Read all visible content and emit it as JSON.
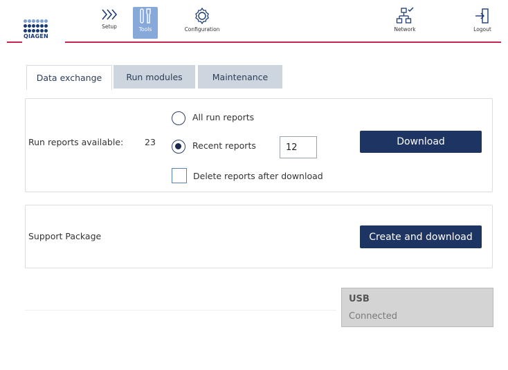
{
  "brand": {
    "logo_text": "QIAGEN",
    "accent_color": "#c8234f",
    "primary_color": "#1e3563"
  },
  "nav": {
    "setup": {
      "label": "Setup",
      "icon": "setup-chevrons-icon"
    },
    "tools": {
      "label": "Tools",
      "icon": "tools-icon",
      "active": true
    },
    "configuration": {
      "label": "Configuration",
      "icon": "gear-icon"
    },
    "network": {
      "label": "Network",
      "icon": "network-connected-icon"
    },
    "logout": {
      "label": "Logout",
      "icon": "logout-icon"
    }
  },
  "tabs": [
    {
      "label": "Data exchange",
      "active": true
    },
    {
      "label": "Run modules",
      "active": false
    },
    {
      "label": "Maintenance",
      "active": false
    }
  ],
  "run_reports": {
    "label": "Run reports available:",
    "count": "23",
    "option_all": "All run reports",
    "option_recent": "Recent reports",
    "selected": "Recent reports",
    "recent_count_value": "12",
    "delete_label": "Delete reports after download",
    "delete_checked": false,
    "download_button": "Download"
  },
  "support": {
    "label": "Support Package",
    "button": "Create and download"
  },
  "usb": {
    "title": "USB",
    "status": "Connected"
  }
}
